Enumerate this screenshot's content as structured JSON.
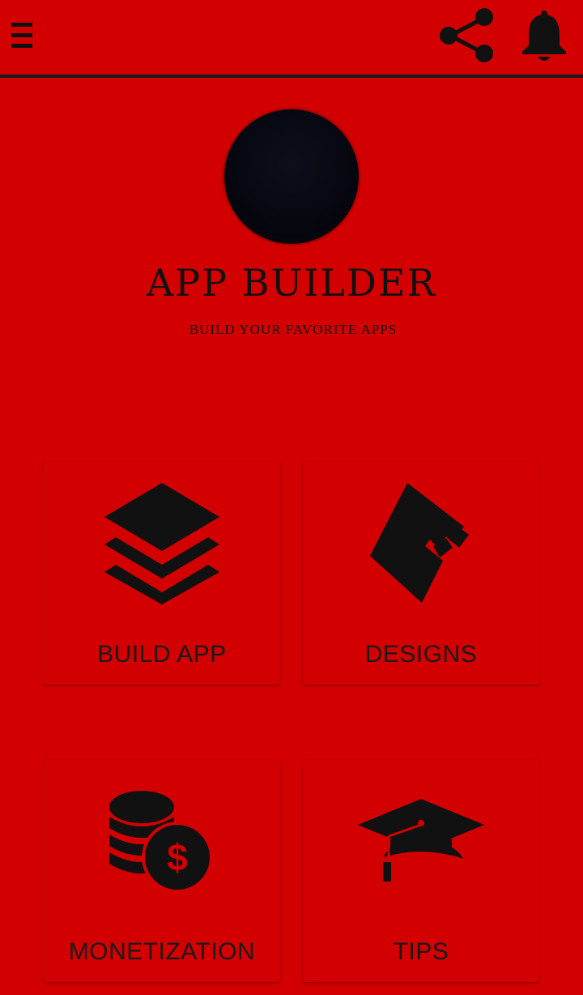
{
  "header": {
    "icons": [
      "menu-icon",
      "share-icon",
      "bell-icon"
    ]
  },
  "profile": {
    "title": "APP BUILDER",
    "subtitle": "BUILD YOUR FAVORITE APPS"
  },
  "cards": [
    {
      "label": "BUILD APP",
      "icon": "layers-icon"
    },
    {
      "label": "DESIGNS",
      "icon": "wallet-icon"
    },
    {
      "label": "MONETIZATION",
      "icon": "coins-dollar-icon"
    },
    {
      "label": "TIPS",
      "icon": "graduation-cap-icon"
    }
  ],
  "colors": {
    "background": "#d30000",
    "foreground": "#111111",
    "divider": "#1a1a1a"
  }
}
